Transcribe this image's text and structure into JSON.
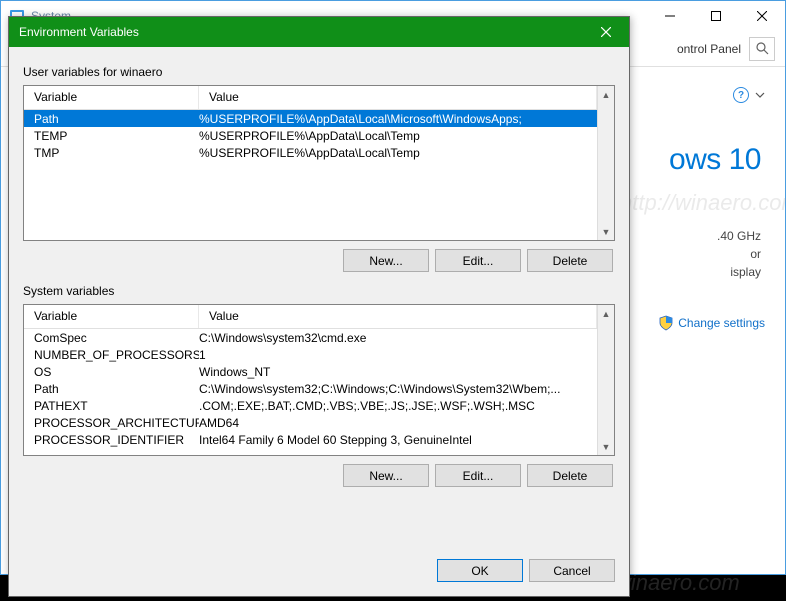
{
  "bg": {
    "title": "System",
    "toolbar": {
      "control_panel": "ontrol Panel"
    },
    "brand": "ows 10",
    "spec1": ".40 GHz",
    "spec2": "or",
    "spec3": "isplay",
    "change": "Change settings"
  },
  "dialog": {
    "title": "Environment Variables"
  },
  "cols": {
    "variable": "Variable",
    "value": "Value"
  },
  "user": {
    "label": "User variables for winaero",
    "rows": [
      {
        "variable": "Path",
        "value": "%USERPROFILE%\\AppData\\Local\\Microsoft\\WindowsApps;",
        "selected": true
      },
      {
        "variable": "TEMP",
        "value": "%USERPROFILE%\\AppData\\Local\\Temp"
      },
      {
        "variable": "TMP",
        "value": "%USERPROFILE%\\AppData\\Local\\Temp"
      }
    ]
  },
  "system": {
    "label": "System variables",
    "rows": [
      {
        "variable": "ComSpec",
        "value": "C:\\Windows\\system32\\cmd.exe"
      },
      {
        "variable": "NUMBER_OF_PROCESSORS",
        "value": "1"
      },
      {
        "variable": "OS",
        "value": "Windows_NT"
      },
      {
        "variable": "Path",
        "value": "C:\\Windows\\system32;C:\\Windows;C:\\Windows\\System32\\Wbem;..."
      },
      {
        "variable": "PATHEXT",
        "value": ".COM;.EXE;.BAT;.CMD;.VBS;.VBE;.JS;.JSE;.WSF;.WSH;.MSC"
      },
      {
        "variable": "PROCESSOR_ARCHITECTURE",
        "value": "AMD64"
      },
      {
        "variable": "PROCESSOR_IDENTIFIER",
        "value": "Intel64 Family 6 Model 60 Stepping 3, GenuineIntel"
      }
    ]
  },
  "buttons": {
    "new": "New...",
    "edit": "Edit...",
    "delete": "Delete",
    "ok": "OK",
    "cancel": "Cancel"
  },
  "watermark": "http://winaero.com"
}
